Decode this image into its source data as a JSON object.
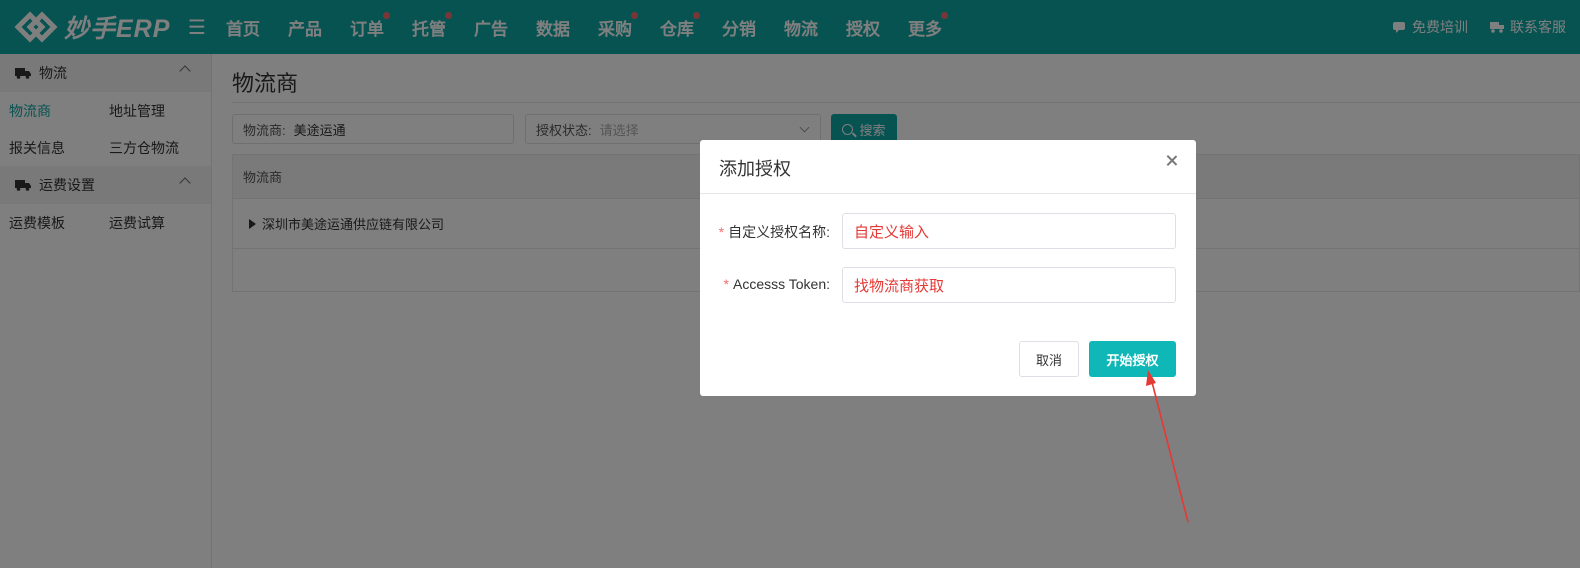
{
  "brand": {
    "name": "妙手ERP"
  },
  "nav": {
    "items": [
      {
        "label": "首页",
        "dot": false
      },
      {
        "label": "产品",
        "dot": false
      },
      {
        "label": "订单",
        "dot": true
      },
      {
        "label": "托管",
        "dot": true
      },
      {
        "label": "广告",
        "dot": false
      },
      {
        "label": "数据",
        "dot": false
      },
      {
        "label": "采购",
        "dot": true
      },
      {
        "label": "仓库",
        "dot": true
      },
      {
        "label": "分销",
        "dot": false
      },
      {
        "label": "物流",
        "dot": false
      },
      {
        "label": "授权",
        "dot": false
      },
      {
        "label": "更多",
        "dot": true
      }
    ],
    "training": "免费培训",
    "support": "联系客服"
  },
  "sidebar": {
    "group1": {
      "title": "物流",
      "items": [
        "物流商",
        "地址管理",
        "报关信息",
        "三方仓物流"
      ]
    },
    "group2": {
      "title": "运费设置",
      "items": [
        "运费模板",
        "运费试算"
      ]
    }
  },
  "main": {
    "title": "物流商",
    "filter_provider": {
      "label": "物流商:",
      "value": "美途运通"
    },
    "filter_status": {
      "label": "授权状态:",
      "placeholder": "请选择"
    },
    "search_label": "搜索",
    "table": {
      "header": "物流商",
      "rows": [
        "深圳市美途运通供应链有限公司"
      ]
    }
  },
  "dialog": {
    "title": "添加授权",
    "field1": {
      "label": "自定义授权名称:",
      "value": "自定义输入"
    },
    "field2": {
      "label": "Accesss Token:",
      "value": "找物流商获取"
    },
    "cancel": "取消",
    "confirm": "开始授权"
  },
  "colors": {
    "brand": "#0fa6a5",
    "primary_button": "#0fb8b6",
    "required": "#f56c6c",
    "annotation": "#e53935"
  }
}
